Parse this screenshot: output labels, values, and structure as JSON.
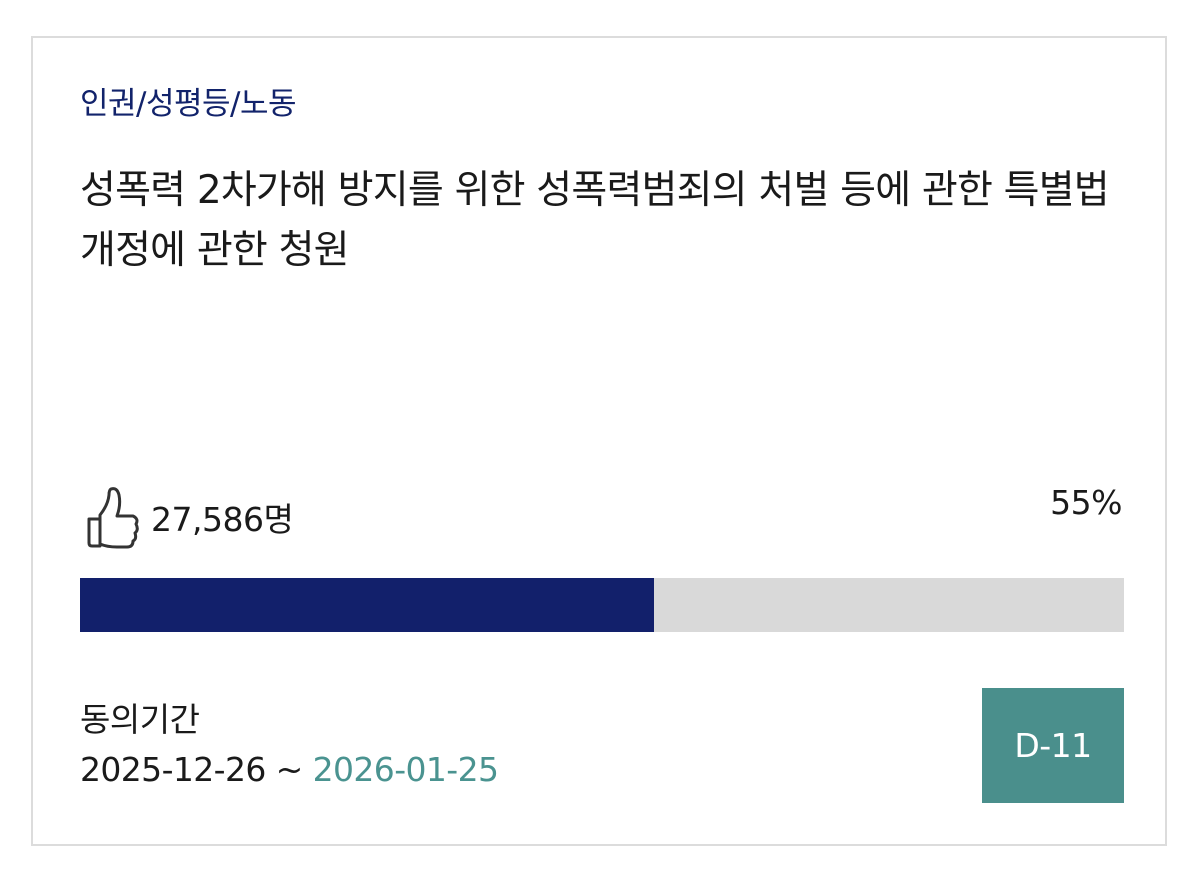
{
  "petition": {
    "category": "인권/성평등/노동",
    "title": "성폭력 2차가해 방지를 위한 성폭력범죄의 처벌 등에 관한 특별법 개정에 관한 청원",
    "agree_count": "27,586명",
    "percent_label": "55%",
    "progress": 0.55,
    "period_label": "동의기간",
    "period_start": "2025-12-26",
    "period_separator": " ~ ",
    "period_end": "2026-01-25",
    "d_day": "D-11"
  },
  "colors": {
    "category": "#12236b",
    "progress_fill": "#12206b",
    "progress_track": "#d9d9d9",
    "end_date": "#4a9390",
    "badge": "#4a8f8c"
  },
  "icons": {
    "agree": "thumbs-up-icon"
  }
}
